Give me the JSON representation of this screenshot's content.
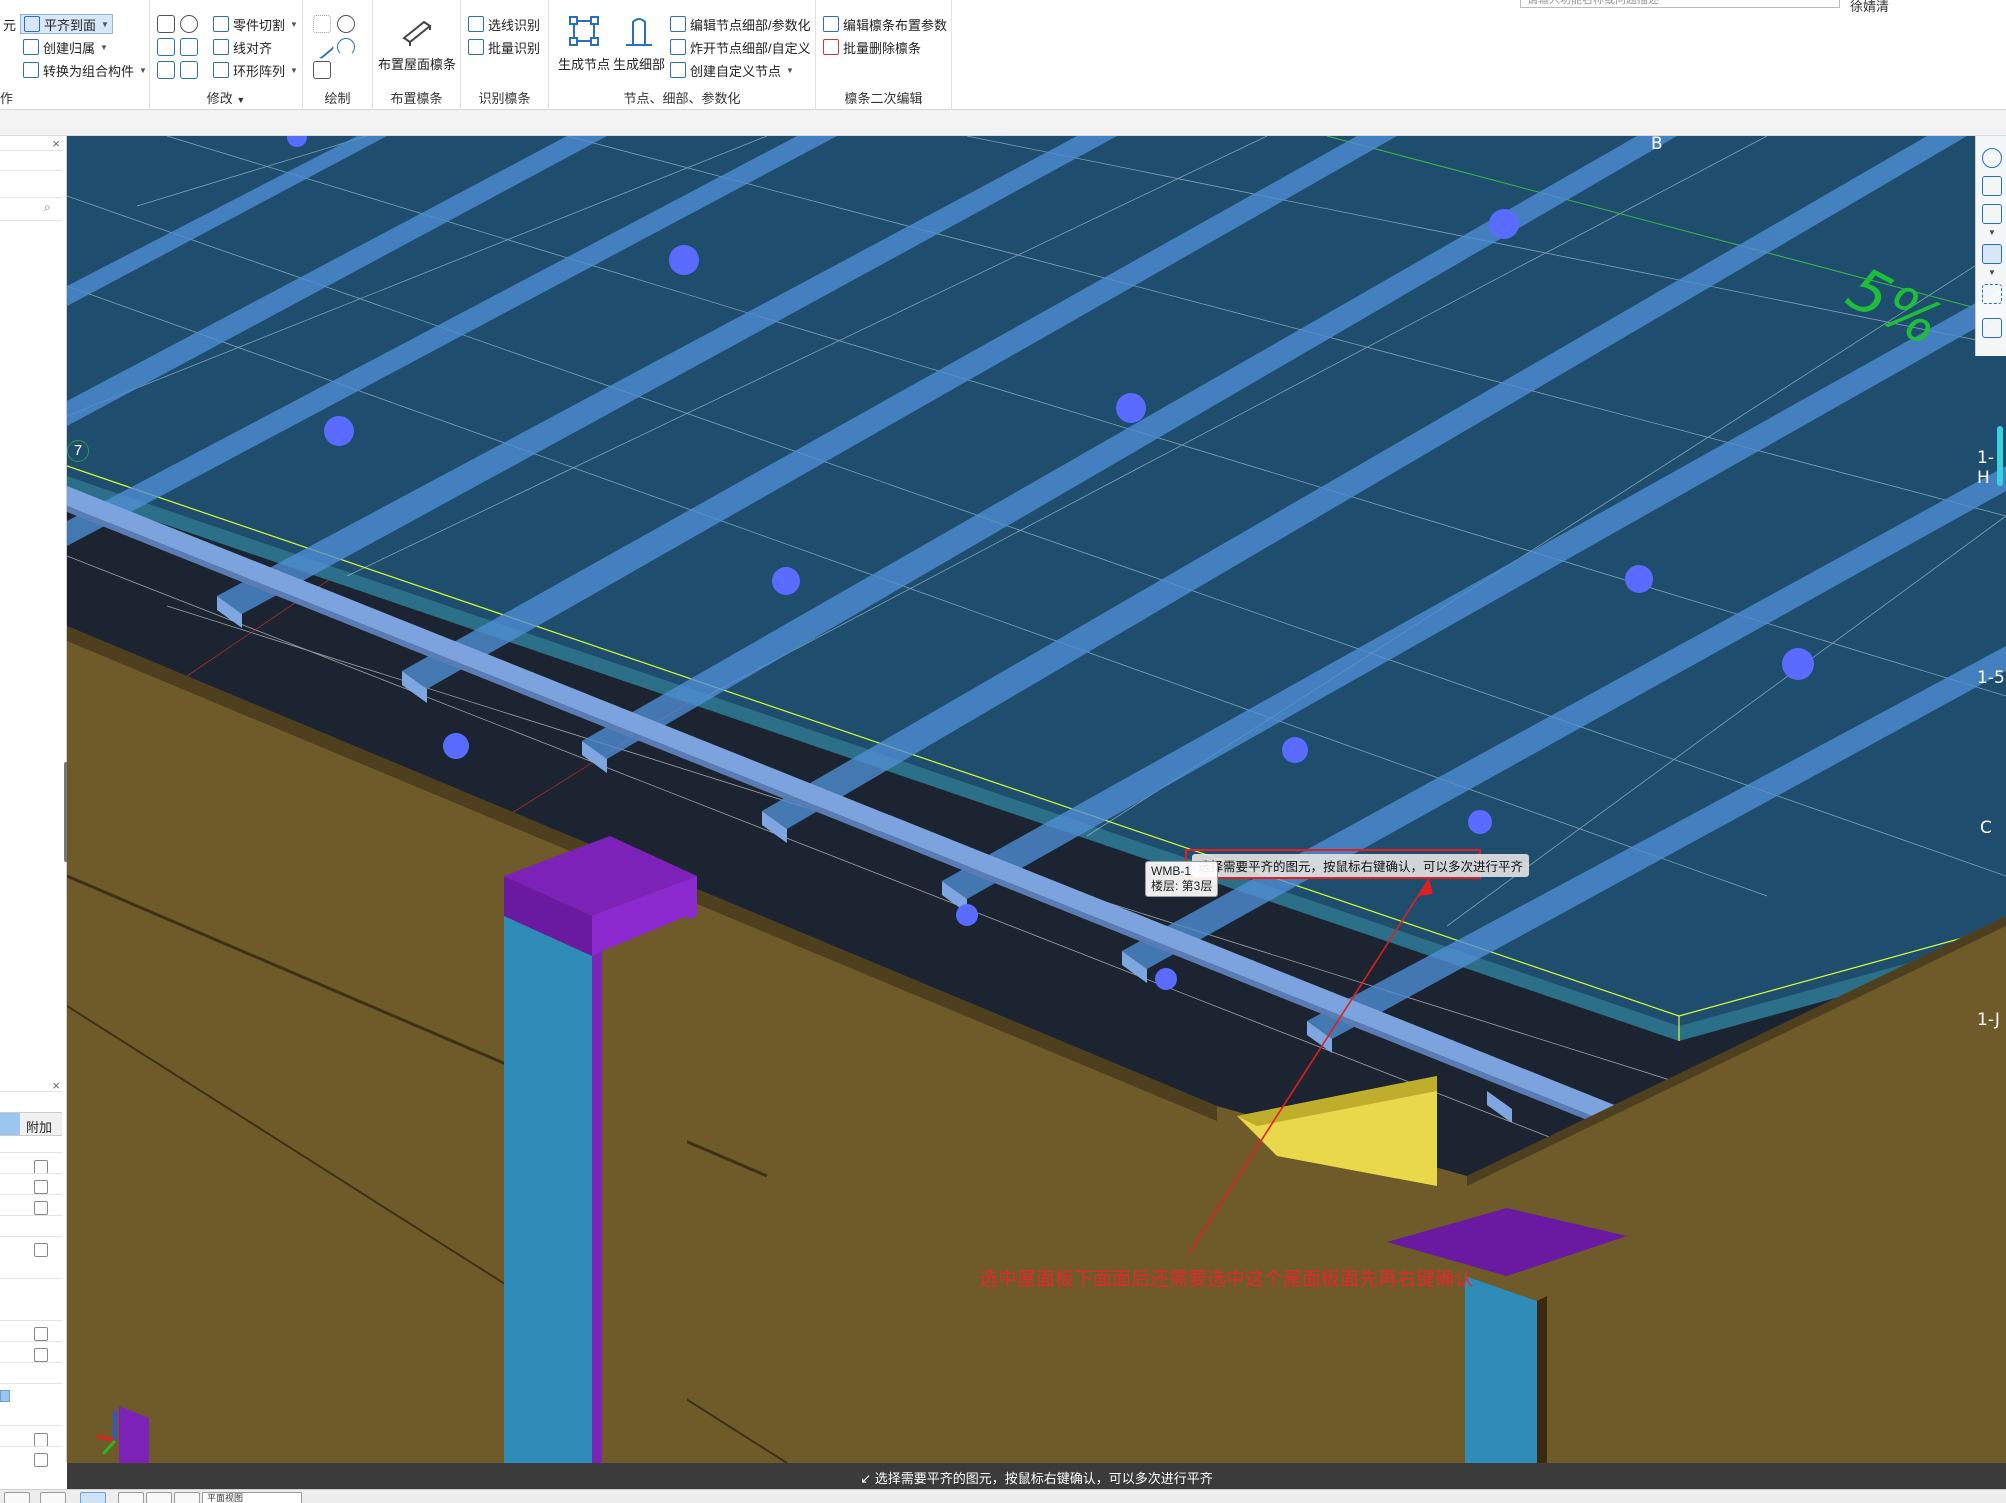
{
  "ribbon": {
    "search_placeholder": "请输入功能名称或问题描述",
    "user_label": "徐婧清",
    "groups": {
      "operation": {
        "label": "作",
        "left_edge_label": "元",
        "items": {
          "align_label": "平齐到面",
          "create_fold_label": "创建归属",
          "convert_combo_label": "转换为组合构件"
        }
      },
      "modify": {
        "label": "修改",
        "items": {
          "part_cut_label": "零件切割",
          "line_align_label": "线对齐",
          "ring_array_label": "环形阵列"
        }
      },
      "draw": {
        "label": "绘制"
      },
      "purlin_layout": {
        "label": "布置檩条",
        "big_button_label": "布置屋面檩条"
      },
      "purlin_identify": {
        "label": "识别檩条",
        "items": {
          "select_identify_label": "选线识别",
          "batch_identify_label": "批量识别"
        }
      },
      "nodes": {
        "label": "节点、细部、参数化",
        "gen_node_label": "生成节点",
        "gen_detail_label": "生成细部",
        "items": {
          "edit_node_label": "编辑节点细部/参数化",
          "explode_node_label": "炸开节点细部/自定义",
          "create_custom_label": "创建自定义节点"
        }
      },
      "purlin_edit": {
        "label": "檩条二次编辑",
        "items": {
          "edit_param_label": "编辑檩条布置参数",
          "batch_delete_label": "批量删除檩条"
        }
      }
    }
  },
  "left_panel": {
    "column_header": "附加"
  },
  "viewport": {
    "axis_labels": {
      "b": "B",
      "c": "C",
      "seven": "7",
      "one_h": "1-H",
      "one_five": "1-5",
      "one_j": "1-J"
    },
    "slope_text": "5%",
    "tooltip": {
      "name": "WMB-1",
      "floor": "楼层: 第3层"
    },
    "hint_bubble": "选择需要平齐的图元，按鼠标右键确认，可以多次进行平齐",
    "annotation": "选中屋面板下面面后还需要选中这个屋面板面先再右键确认"
  },
  "status_bar": {
    "message": "选择需要平齐的图元，按鼠标右键确认，可以多次进行平齐"
  },
  "bottom_bar": {
    "select_value": "平面视图"
  },
  "colors": {
    "roof_panel": "#1f4f6f",
    "purlin": "#5b8ed0",
    "wall": "#6f5a2a",
    "purple": "#8420c0",
    "column": "#2f8bb7",
    "highlight_red": "#e02020",
    "slope_green": "#1fbe3a"
  }
}
